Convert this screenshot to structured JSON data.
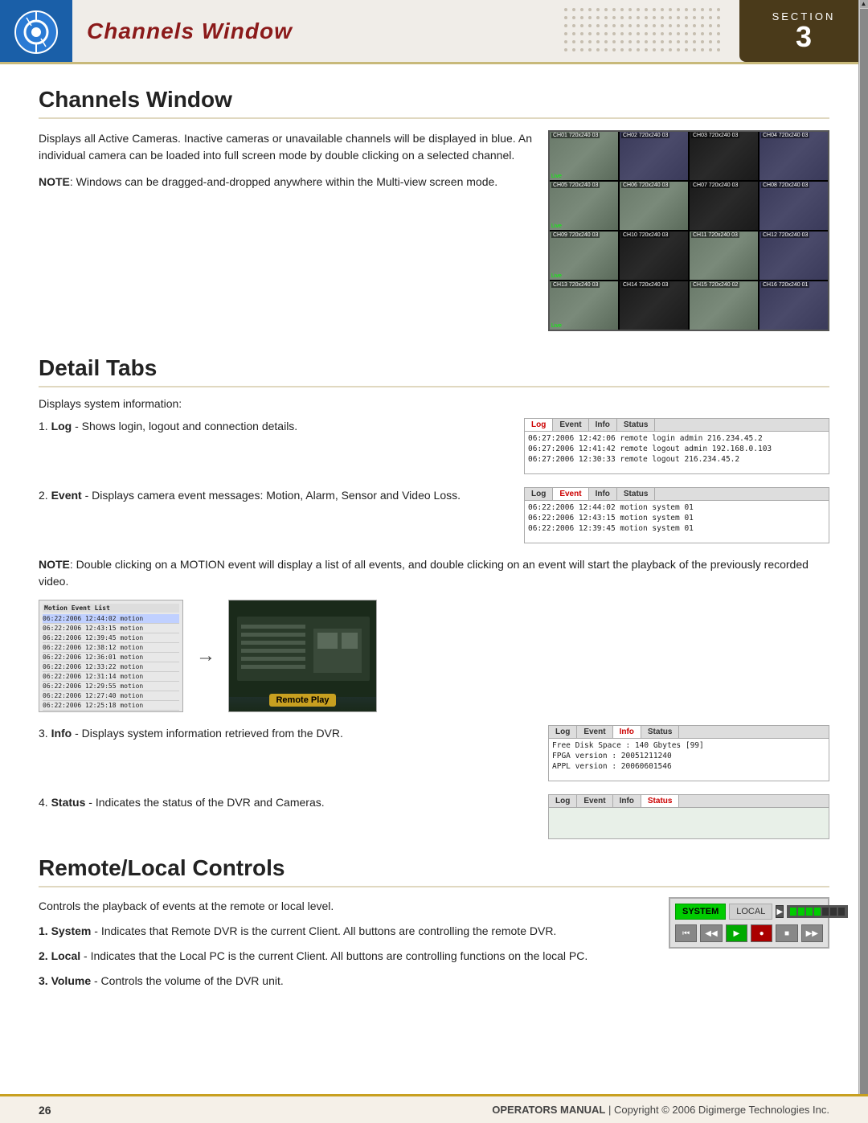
{
  "header": {
    "title": "Channels Window",
    "section_label": "SECTION",
    "section_number": "3",
    "logo_alt": "Digimerge logo"
  },
  "channels_window": {
    "heading": "Channels Window",
    "body": "Displays all Active Cameras. Inactive cameras or unavailable channels will be displayed in blue. An individual camera can be loaded into full screen mode by double clicking on a selected channel.",
    "note_label": "NOTE",
    "note": "Windows can be dragged-and-dropped anywhere within the Multi-view screen mode.",
    "cameras": [
      {
        "label": "CH01 720x240 03",
        "live": "Live",
        "style": "light"
      },
      {
        "label": "CH02 720x240 03",
        "live": "",
        "style": "office"
      },
      {
        "label": "CH03 720x240 03",
        "live": "",
        "style": "dark"
      },
      {
        "label": "CH04 720x240 03",
        "live": "",
        "style": "office"
      },
      {
        "label": "CH05 720x240 03",
        "live": "Live",
        "style": "light"
      },
      {
        "label": "CH06 720x240 03",
        "live": "",
        "style": "light"
      },
      {
        "label": "CH07 720x240 03",
        "live": "",
        "style": "dark"
      },
      {
        "label": "CH08 720x240 03",
        "live": "",
        "style": "office"
      },
      {
        "label": "CH09 720x240 03",
        "live": "Live",
        "style": "light"
      },
      {
        "label": "CH10 720x240 03",
        "live": "",
        "style": "dark"
      },
      {
        "label": "CH11 720x240 03",
        "live": "",
        "style": "light"
      },
      {
        "label": "CH12 720x240 03",
        "live": "",
        "style": "office"
      },
      {
        "label": "CH13 720x240 03",
        "live": "Live",
        "style": "light"
      },
      {
        "label": "CH14 720x240 03",
        "live": "",
        "style": "dark"
      },
      {
        "label": "CH15 720x240 02",
        "live": "",
        "style": "light"
      },
      {
        "label": "CH16 720x240 01",
        "live": "",
        "style": "office"
      }
    ]
  },
  "detail_tabs": {
    "heading": "Detail Tabs",
    "intro": "Displays system information:",
    "tabs": [
      "Log",
      "Event",
      "Info",
      "Status"
    ],
    "items": [
      {
        "number": "1",
        "term": "Log",
        "description": "Shows login, logout and connection details.",
        "log_rows": [
          "06:27:2006 12:42:06 remote login       admin  216.234.45.2",
          "06:27:2006 12:41:42 remote logout      admin  192.168.0.103",
          "06:27:2006 12:30:33 remote logout             216.234.45.2"
        ],
        "active_tab": "Log"
      },
      {
        "number": "2",
        "term": "Event",
        "description": "Displays camera event messages: Motion, Alarm, Sensor and Video Loss.",
        "log_rows": [
          "06:22:2006 12:44:02 motion             system  01",
          "06:22:2006 12:43:15 motion             system  01",
          "06:22:2006 12:39:45 motion             system  01"
        ],
        "active_tab": "Event"
      }
    ],
    "note_label": "NOTE",
    "motion_note": "Double clicking on a MOTION event will display a list of all events, and double clicking on an event will start the playback of the previously recorded video.",
    "remote_play_label": "Remote Play",
    "info_item": {
      "number": "3",
      "term": "Info",
      "description": "Displays system information retrieved from the DVR.",
      "log_rows": [
        "Free Disk Space : 140 Gbytes [99]",
        "FPGA   version : 20051211240",
        "APPL   version : 20060601546"
      ],
      "active_tab": "Info"
    },
    "status_item": {
      "number": "4",
      "term": "Status",
      "description": "Indicates the status of the DVR and Cameras.",
      "active_tab": "Status"
    }
  },
  "remote_local": {
    "heading": "Remote/Local Controls",
    "intro": "Controls the playback of events at the remote or local level.",
    "items": [
      {
        "number": "1",
        "term": "System",
        "description": "Indicates that Remote DVR is the current Client. All buttons are controlling the remote DVR."
      },
      {
        "number": "2",
        "term": "Local",
        "description": "Indicates that the Local PC is the current Client. All buttons are controlling functions on the local PC."
      },
      {
        "number": "3",
        "term": "Volume",
        "description": "Controls the volume of the DVR unit."
      }
    ],
    "controls": {
      "system_label": "SYSTEM",
      "local_label": "LOCAL"
    }
  },
  "footer": {
    "page_number": "26",
    "manual_title": "OPERATORS MANUAL",
    "separator": "|",
    "copyright": "Copyright © 2006 Digimerge Technologies Inc."
  },
  "motion_list_rows": [
    "06:22:2006 12:44:02 motion",
    "06:22:2006 12:43:15 motion",
    "06:22:2006 12:39:45 motion",
    "06:22:2006 12:38:12 motion",
    "06:22:2006 12:36:01 motion",
    "06:22:2006 12:33:22 motion",
    "06:22:2006 12:31:14 motion",
    "06:22:2006 12:29:55 motion",
    "06:22:2006 12:27:40 motion",
    "06:22:2006 12:25:18 motion"
  ]
}
